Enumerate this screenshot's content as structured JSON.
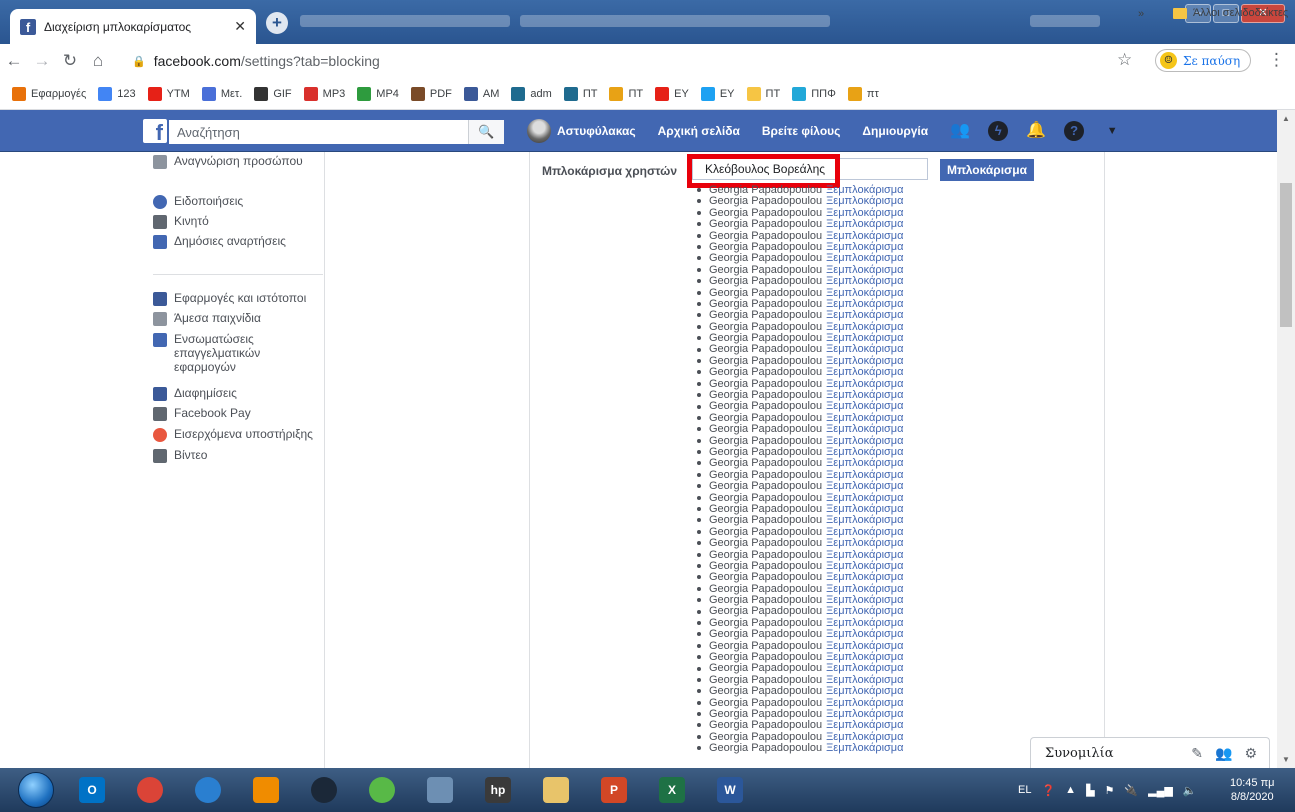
{
  "browser": {
    "tab_title": "Διαχείριση μπλοκαρίσματος",
    "url_host": "facebook.com",
    "url_path": "/settings?tab=blocking",
    "profile_status": "Σε παύση",
    "bookmarks": [
      {
        "label": "Εφαρμογές",
        "icon": "apps-grid-icon",
        "color": "#e8710a"
      },
      {
        "label": "123",
        "icon": "google-icon",
        "color": "#4285f4"
      },
      {
        "label": "YTM",
        "icon": "youtube-music-icon",
        "color": "#e62117"
      },
      {
        "label": "Μετ.",
        "icon": "translate-icon",
        "color": "#4a6fd8"
      },
      {
        "label": "GIF",
        "icon": "gif-icon",
        "color": "#333333"
      },
      {
        "label": "MP3",
        "icon": "mp3-icon",
        "color": "#d9302c"
      },
      {
        "label": "MP4",
        "icon": "download-arrow-icon",
        "color": "#2e9b3e"
      },
      {
        "label": "PDF",
        "icon": "pdf-icon",
        "color": "#7a4b28"
      },
      {
        "label": "AM",
        "icon": "facebook-icon",
        "color": "#3b5998"
      },
      {
        "label": "adm",
        "icon": "adm-icon",
        "color": "#1f6b8f"
      },
      {
        "label": "ΠΤ",
        "icon": "pt-icon",
        "color": "#1f6b8f"
      },
      {
        "label": "ΠΤ",
        "icon": "signal-bars-icon",
        "color": "#e8a215"
      },
      {
        "label": "ΕΥ",
        "icon": "youtube-icon",
        "color": "#e62117"
      },
      {
        "label": "ΕΥ",
        "icon": "twitter-icon",
        "color": "#1da1f2"
      },
      {
        "label": "ΠΤ",
        "icon": "folder-icon",
        "color": "#f6c544"
      },
      {
        "label": "ΠΠΦ",
        "icon": "ppf-icon",
        "color": "#22a8d8"
      },
      {
        "label": "πτ",
        "icon": "signal-bars-icon",
        "color": "#e8a215"
      }
    ],
    "bookmarks_more": "»",
    "other_bookmarks": "Άλλοι σελιδοδείκτες"
  },
  "fb_header": {
    "search_placeholder": "Αναζήτηση",
    "profile_name": "Αστυφύλακας",
    "nav": [
      "Αρχική σελίδα",
      "Βρείτε φίλους",
      "Δημιουργία"
    ]
  },
  "sidebar": {
    "items": [
      {
        "label": "Αναγνώριση προσώπου",
        "icon": "face-recognition-icon",
        "color": "#8d949e"
      },
      {
        "label": "Ειδοποιήσεις",
        "icon": "globe-icon",
        "color": "#4267b2"
      },
      {
        "label": "Κινητό",
        "icon": "mobile-icon",
        "color": "#606770"
      },
      {
        "label": "Δημόσιες αναρτήσεις",
        "icon": "rss-icon",
        "color": "#4267b2"
      },
      {
        "label": "Εφαρμογές και ιστότοποι",
        "icon": "apps-icon",
        "color": "#3b5998"
      },
      {
        "label": "Άμεσα παιχνίδια",
        "icon": "gamepad-icon",
        "color": "#8d949e"
      },
      {
        "label": "Ενσωματώσεις επαγγελματικών εφαρμογών",
        "icon": "business-integrations-icon",
        "color": "#4267b2"
      },
      {
        "label": "Διαφημίσεις",
        "icon": "ads-icon",
        "color": "#3b5998"
      },
      {
        "label": "Facebook Pay",
        "icon": "card-icon",
        "color": "#606770"
      },
      {
        "label": "Εισερχόμενα υποστήριξης",
        "icon": "lifebuoy-icon",
        "color": "#e9573f"
      },
      {
        "label": "Βίντεο",
        "icon": "film-icon",
        "color": "#606770"
      }
    ]
  },
  "blocking": {
    "label": "Μπλοκάρισμα χρηστών",
    "input_value": "Κλεόβουλος Βορεάλης",
    "button": "Μπλοκάρισμα",
    "blocked_users": [
      {
        "name": "Georgia Papadopoulou",
        "action": "Ξεμπλοκάρισμα"
      },
      {
        "name": "Georgia Papadopoulou",
        "action": "Ξεμπλοκάρισμα"
      },
      {
        "name": "Georgia Papadopoulou",
        "action": "Ξεμπλοκάρισμα"
      },
      {
        "name": "Georgia Papadopoulou",
        "action": "Ξεμπλοκάρισμα"
      },
      {
        "name": "Georgia Papadopoulou",
        "action": "Ξεμπλοκάρισμα"
      },
      {
        "name": "Georgia Papadopoulou",
        "action": "Ξεμπλοκάρισμα"
      },
      {
        "name": "Georgia Papadopoulou",
        "action": "Ξεμπλοκάρισμα"
      },
      {
        "name": "Georgia Papadopoulou",
        "action": "Ξεμπλοκάρισμα"
      },
      {
        "name": "Georgia Papadopoulou",
        "action": "Ξεμπλοκάρισμα"
      },
      {
        "name": "Georgia Papadopoulou",
        "action": "Ξεμπλοκάρισμα"
      },
      {
        "name": "Georgia Papadopoulou",
        "action": "Ξεμπλοκάρισμα"
      },
      {
        "name": "Georgia Papadopoulou",
        "action": "Ξεμπλοκάρισμα"
      },
      {
        "name": "Georgia Papadopoulou",
        "action": "Ξεμπλοκάρισμα"
      },
      {
        "name": "Georgia Papadopoulou",
        "action": "Ξεμπλοκάρισμα"
      },
      {
        "name": "Georgia Papadopoulou",
        "action": "Ξεμπλοκάρισμα"
      },
      {
        "name": "Georgia Papadopoulou",
        "action": "Ξεμπλοκάρισμα"
      },
      {
        "name": "Georgia Papadopoulou",
        "action": "Ξεμπλοκάρισμα"
      },
      {
        "name": "Georgia Papadopoulou",
        "action": "Ξεμπλοκάρισμα"
      },
      {
        "name": "Georgia Papadopoulou",
        "action": "Ξεμπλοκάρισμα"
      },
      {
        "name": "Georgia Papadopoulou",
        "action": "Ξεμπλοκάρισμα"
      },
      {
        "name": "Georgia Papadopoulou",
        "action": "Ξεμπλοκάρισμα"
      },
      {
        "name": "Georgia Papadopoulou",
        "action": "Ξεμπλοκάρισμα"
      },
      {
        "name": "Georgia Papadopoulou",
        "action": "Ξεμπλοκάρισμα"
      },
      {
        "name": "Georgia Papadopoulou",
        "action": "Ξεμπλοκάρισμα"
      },
      {
        "name": "Georgia Papadopoulou",
        "action": "Ξεμπλοκάρισμα"
      },
      {
        "name": "Georgia Papadopoulou",
        "action": "Ξεμπλοκάρισμα"
      },
      {
        "name": "Georgia Papadopoulou",
        "action": "Ξεμπλοκάρισμα"
      },
      {
        "name": "Georgia Papadopoulou",
        "action": "Ξεμπλοκάρισμα"
      },
      {
        "name": "Georgia Papadopoulou",
        "action": "Ξεμπλοκάρισμα"
      },
      {
        "name": "Georgia Papadopoulou",
        "action": "Ξεμπλοκάρισμα"
      },
      {
        "name": "Georgia Papadopoulou",
        "action": "Ξεμπλοκάρισμα"
      },
      {
        "name": "Georgia Papadopoulou",
        "action": "Ξεμπλοκάρισμα"
      },
      {
        "name": "Georgia Papadopoulou",
        "action": "Ξεμπλοκάρισμα"
      },
      {
        "name": "Georgia Papadopoulou",
        "action": "Ξεμπλοκάρισμα"
      },
      {
        "name": "Georgia Papadopoulou",
        "action": "Ξεμπλοκάρισμα"
      },
      {
        "name": "Georgia Papadopoulou",
        "action": "Ξεμπλοκάρισμα"
      },
      {
        "name": "Georgia Papadopoulou",
        "action": "Ξεμπλοκάρισμα"
      },
      {
        "name": "Georgia Papadopoulou",
        "action": "Ξεμπλοκάρισμα"
      },
      {
        "name": "Georgia Papadopoulou",
        "action": "Ξεμπλοκάρισμα"
      },
      {
        "name": "Georgia Papadopoulou",
        "action": "Ξεμπλοκάρισμα"
      },
      {
        "name": "Georgia Papadopoulou",
        "action": "Ξεμπλοκάρισμα"
      },
      {
        "name": "Georgia Papadopoulou",
        "action": "Ξεμπλοκάρισμα"
      },
      {
        "name": "Georgia Papadopoulou",
        "action": "Ξεμπλοκάρισμα"
      },
      {
        "name": "Georgia Papadopoulou",
        "action": "Ξεμπλοκάρισμα"
      },
      {
        "name": "Georgia Papadopoulou",
        "action": "Ξεμπλοκάρισμα"
      },
      {
        "name": "Georgia Papadopoulou",
        "action": "Ξεμπλοκάρισμα"
      },
      {
        "name": "Georgia Papadopoulou",
        "action": "Ξεμπλοκάρισμα"
      },
      {
        "name": "Georgia Papadopoulou",
        "action": "Ξεμπλοκάρισμα"
      },
      {
        "name": "Georgia Papadopoulou",
        "action": "Ξεμπλοκάρισμα"
      },
      {
        "name": "Georgia Papadopoulou",
        "action": "Ξεμπλοκάρισμα"
      }
    ]
  },
  "chat": {
    "title": "Συνομιλία"
  },
  "taskbar": {
    "apps": [
      {
        "icon": "outlook-icon",
        "color": "#0072c6",
        "label": "O"
      },
      {
        "icon": "chrome-icon",
        "color": "#db4437",
        "label": ""
      },
      {
        "icon": "browser-icon",
        "color": "#2a7fd0",
        "label": ""
      },
      {
        "icon": "vlc-icon",
        "color": "#f08c00",
        "label": ""
      },
      {
        "icon": "steam-icon",
        "color": "#1b2838",
        "label": ""
      },
      {
        "icon": "green-app-icon",
        "color": "#58b947",
        "label": ""
      },
      {
        "icon": "calculator-icon",
        "color": "#6d8fb3",
        "label": ""
      },
      {
        "icon": "hp-icon",
        "color": "#3a3a3a",
        "label": "hp"
      },
      {
        "icon": "file-explorer-icon",
        "color": "#e8c46a",
        "label": ""
      },
      {
        "icon": "powerpoint-icon",
        "color": "#d24726",
        "label": "P"
      },
      {
        "icon": "excel-icon",
        "color": "#1e7145",
        "label": "X"
      },
      {
        "icon": "word-icon",
        "color": "#2b579a",
        "label": "W"
      }
    ],
    "language": "EL",
    "time": "10:45 πμ",
    "date": "8/8/2020"
  },
  "colors": {
    "fb_blue": "#4267b2",
    "highlight_red": "#e8000b"
  }
}
